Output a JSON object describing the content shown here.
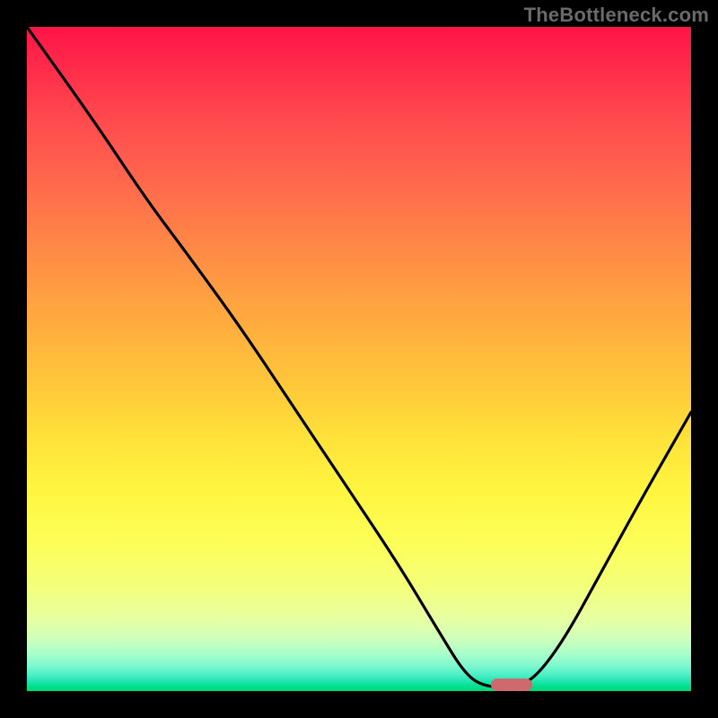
{
  "watermark": "TheBottleneck.com",
  "chart_data": {
    "type": "line",
    "title": "",
    "xlabel": "",
    "ylabel": "",
    "xlim": [
      0,
      100
    ],
    "ylim": [
      0,
      100
    ],
    "curve": [
      {
        "x": 0,
        "y": 100
      },
      {
        "x": 10,
        "y": 86
      },
      {
        "x": 18,
        "y": 74
      },
      {
        "x": 24,
        "y": 66
      },
      {
        "x": 32,
        "y": 55
      },
      {
        "x": 40,
        "y": 43
      },
      {
        "x": 48,
        "y": 31
      },
      {
        "x": 56,
        "y": 19
      },
      {
        "x": 62,
        "y": 9
      },
      {
        "x": 66,
        "y": 2.5
      },
      {
        "x": 69,
        "y": 0.6
      },
      {
        "x": 74,
        "y": 0.6
      },
      {
        "x": 77,
        "y": 2.5
      },
      {
        "x": 81,
        "y": 8
      },
      {
        "x": 86,
        "y": 17
      },
      {
        "x": 92,
        "y": 28
      },
      {
        "x": 100,
        "y": 42
      }
    ],
    "marker": {
      "x": 73,
      "y": 0.9,
      "color": "#cd6a6e"
    },
    "gradient_colors": {
      "top": "#ff1447",
      "mid": "#ffe23a",
      "bottom": "#00d876"
    }
  }
}
